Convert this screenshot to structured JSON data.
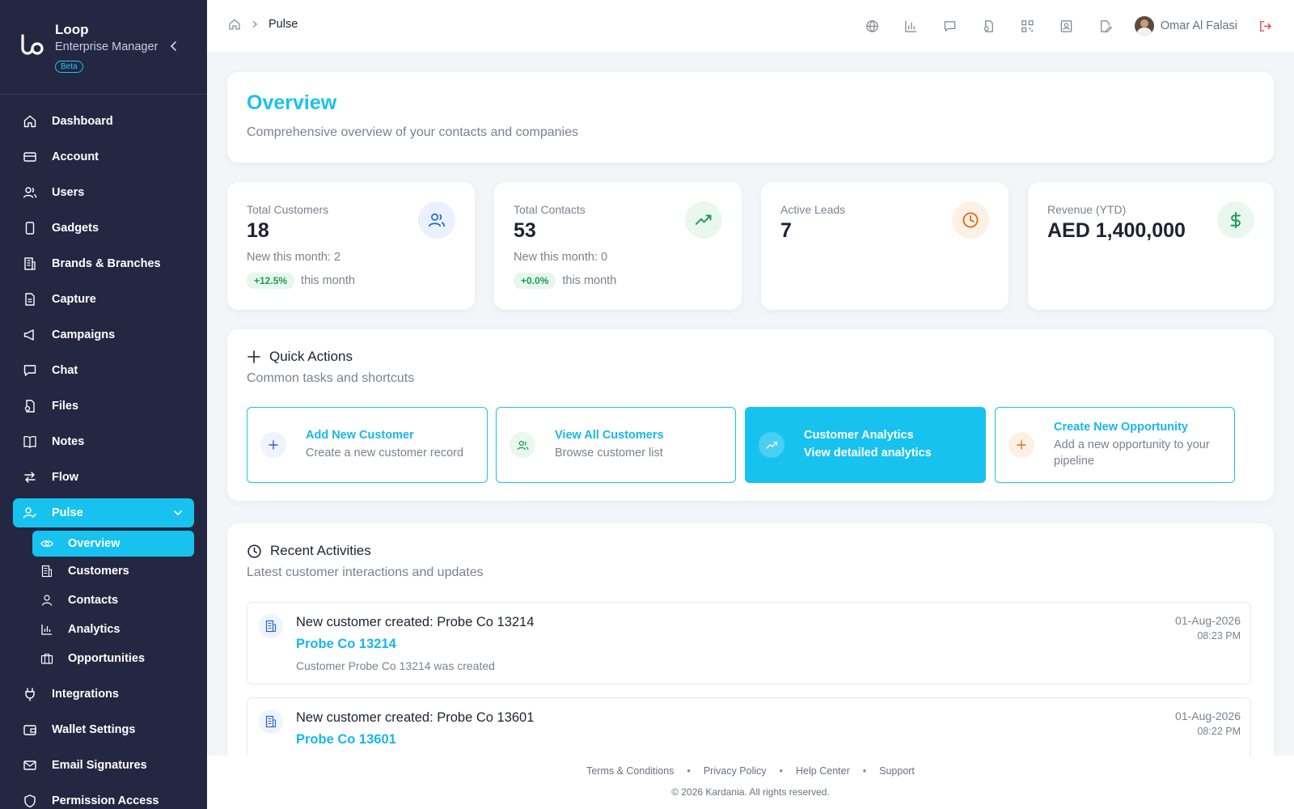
{
  "brand": {
    "name": "Loop",
    "subtitle": "Enterprise Manager",
    "badge": "Beta"
  },
  "sidebar": {
    "items": [
      {
        "label": "Dashboard",
        "icon": "home-icon"
      },
      {
        "label": "Account",
        "icon": "card-icon"
      },
      {
        "label": "Users",
        "icon": "users-icon"
      },
      {
        "label": "Gadgets",
        "icon": "phone-icon"
      },
      {
        "label": "Brands & Branches",
        "icon": "building-icon"
      },
      {
        "label": "Capture",
        "icon": "file-icon"
      },
      {
        "label": "Campaigns",
        "icon": "megaphone-icon"
      },
      {
        "label": "Chat",
        "icon": "chat-icon"
      },
      {
        "label": "Files",
        "icon": "files-icon"
      },
      {
        "label": "Notes",
        "icon": "book-icon"
      },
      {
        "label": "Flow",
        "icon": "flow-icon"
      }
    ],
    "pulse": {
      "label": "Pulse",
      "icon": "pulse-icon"
    },
    "sub_items": [
      {
        "label": "Overview",
        "icon": "eye-icon"
      },
      {
        "label": "Customers",
        "icon": "building-icon"
      },
      {
        "label": "Contacts",
        "icon": "user-icon"
      },
      {
        "label": "Analytics",
        "icon": "bar-chart-icon"
      },
      {
        "label": "Opportunities",
        "icon": "briefcase-icon"
      }
    ],
    "bottom_items": [
      {
        "label": "Integrations",
        "icon": "plug-icon"
      },
      {
        "label": "Wallet Settings",
        "icon": "wallet-icon"
      },
      {
        "label": "Email Signatures",
        "icon": "mail-icon"
      },
      {
        "label": "Permission Access",
        "icon": "shield-icon"
      }
    ]
  },
  "topbar": {
    "breadcrumb_current": "Pulse",
    "user_name": "Omar Al Falasi"
  },
  "overview": {
    "title": "Overview",
    "subtitle": "Comprehensive overview of your contacts and companies"
  },
  "stats": [
    {
      "label": "Total Customers",
      "value": "18",
      "new": "New this month: 2",
      "trend": "+12.5%",
      "trend_suffix": "this month",
      "icon": "users-icon",
      "icon_color": "#2a63d4",
      "icon_bg": "#eaf1fc"
    },
    {
      "label": "Total Contacts",
      "value": "53",
      "new": "New this month: 0",
      "trend": "+0.0%",
      "trend_suffix": "this month",
      "icon": "trending-up-icon",
      "icon_color": "#1e9b52",
      "icon_bg": "#eaf7ef"
    },
    {
      "label": "Active Leads",
      "value": "7",
      "icon": "clock-icon",
      "icon_color": "#e0711c",
      "icon_bg": "#fdf1e6"
    },
    {
      "label": "Revenue (YTD)",
      "value": "AED 1,400,000",
      "icon": "dollar-icon",
      "icon_color": "#1e9b52",
      "icon_bg": "#eaf7ef"
    }
  ],
  "quick_actions": {
    "title": "Quick Actions",
    "subtitle": "Common tasks and shortcuts",
    "items": [
      {
        "title": "Add New Customer",
        "desc": "Create a new customer record",
        "icon": "plus-icon"
      },
      {
        "title": "View All Customers",
        "desc": "Browse customer list",
        "icon": "users-icon"
      },
      {
        "title": "Customer Analytics",
        "desc": "View detailed analytics",
        "icon": "trending-up-icon"
      },
      {
        "title": "Create New Opportunity",
        "desc": "Add a new opportunity to your pipeline",
        "icon": "plus-icon"
      }
    ]
  },
  "activities": {
    "title": "Recent Activities",
    "subtitle": "Latest customer interactions and updates",
    "items": [
      {
        "title": "New customer created: Probe Co 13214",
        "name": "Probe Co 13214",
        "desc": "Customer Probe Co 13214 was created",
        "date": "01-Aug-2026",
        "time": "08:23 PM"
      },
      {
        "title": "New customer created: Probe Co 13601",
        "name": "Probe Co 13601",
        "desc": "",
        "date": "01-Aug-2026",
        "time": "08:22 PM"
      }
    ]
  },
  "footer": {
    "links": [
      "Terms & Conditions",
      "Privacy Policy",
      "Help Center",
      "Support"
    ],
    "copyright": "© 2026 Kardania. All rights reserved."
  },
  "colors": {
    "accent": "#17c2ef",
    "sidebar_bg": "#232741",
    "logout": "#e5484d"
  }
}
